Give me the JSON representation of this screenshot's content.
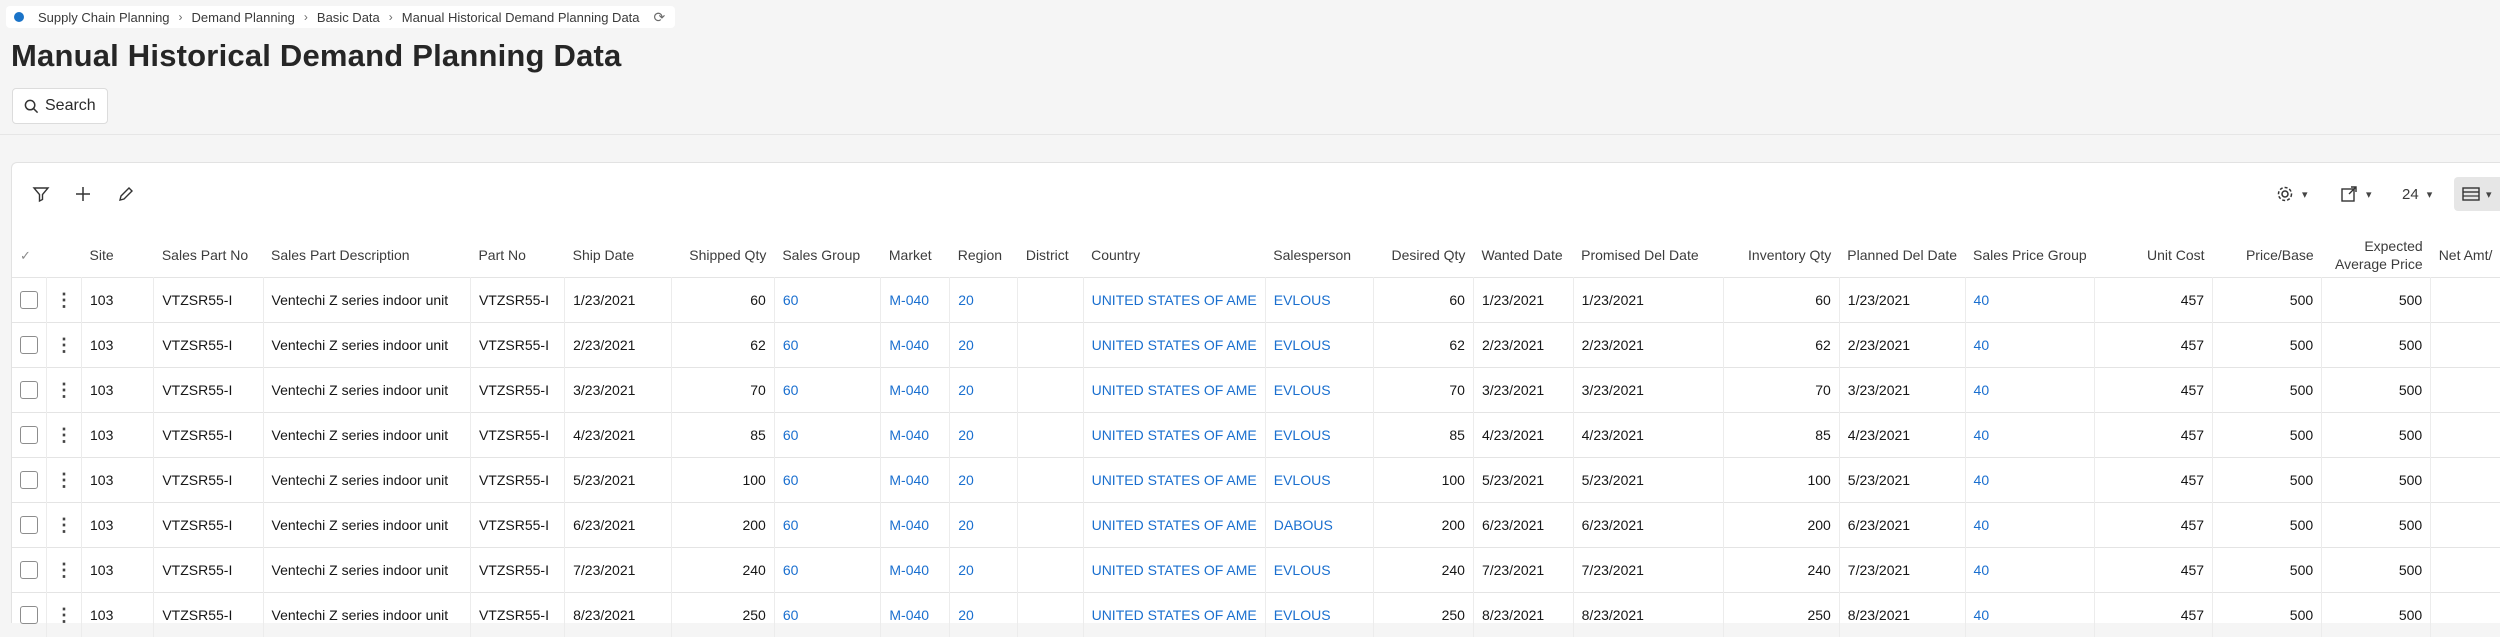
{
  "breadcrumb": [
    "Supply Chain Planning",
    "Demand Planning",
    "Basic Data",
    "Manual Historical Demand Planning Data"
  ],
  "page_title": "Manual Historical Demand Planning Data",
  "search_label": "Search",
  "toolbar": {
    "page_size": "24"
  },
  "columns": {
    "site": "Site",
    "sales_part_no": "Sales Part No",
    "sales_part_desc": "Sales Part Description",
    "part_no": "Part No",
    "ship_date": "Ship Date",
    "shipped_qty": "Shipped Qty",
    "sales_group": "Sales Group",
    "market": "Market",
    "region": "Region",
    "district": "District",
    "country": "Country",
    "salesperson": "Salesperson",
    "desired_qty": "Desired Qty",
    "wanted_date": "Wanted Date",
    "promised_del_date": "Promised Del Date",
    "inventory_qty": "Inventory Qty",
    "planned_del_date": "Planned Del Date",
    "sales_price_group": "Sales Price Group",
    "unit_cost": "Unit Cost",
    "price_base": "Price/Base",
    "expected_avg_price_1": "Expected",
    "expected_avg_price_2": "Average Price",
    "net_amt": "Net Amt/"
  },
  "rows": [
    {
      "site": "103",
      "sales_part_no": "VTZSR55-I",
      "sales_part_desc": "Ventechi Z series indoor unit",
      "part_no": "VTZSR55-I",
      "ship_date": "1/23/2021",
      "shipped_qty": "60",
      "sales_group": "60",
      "market": "M-040",
      "region": "20",
      "district": "",
      "country": "UNITED STATES OF AME",
      "salesperson": "EVLOUS",
      "desired_qty": "60",
      "wanted_date": "1/23/2021",
      "promised_del_date": "1/23/2021",
      "inventory_qty": "60",
      "planned_del_date": "1/23/2021",
      "sales_price_group": "40",
      "unit_cost": "457",
      "price_base": "500",
      "expected_avg_price": "500"
    },
    {
      "site": "103",
      "sales_part_no": "VTZSR55-I",
      "sales_part_desc": "Ventechi Z series indoor unit",
      "part_no": "VTZSR55-I",
      "ship_date": "2/23/2021",
      "shipped_qty": "62",
      "sales_group": "60",
      "market": "M-040",
      "region": "20",
      "district": "",
      "country": "UNITED STATES OF AME",
      "salesperson": "EVLOUS",
      "desired_qty": "62",
      "wanted_date": "2/23/2021",
      "promised_del_date": "2/23/2021",
      "inventory_qty": "62",
      "planned_del_date": "2/23/2021",
      "sales_price_group": "40",
      "unit_cost": "457",
      "price_base": "500",
      "expected_avg_price": "500"
    },
    {
      "site": "103",
      "sales_part_no": "VTZSR55-I",
      "sales_part_desc": "Ventechi Z series indoor unit",
      "part_no": "VTZSR55-I",
      "ship_date": "3/23/2021",
      "shipped_qty": "70",
      "sales_group": "60",
      "market": "M-040",
      "region": "20",
      "district": "",
      "country": "UNITED STATES OF AME",
      "salesperson": "EVLOUS",
      "desired_qty": "70",
      "wanted_date": "3/23/2021",
      "promised_del_date": "3/23/2021",
      "inventory_qty": "70",
      "planned_del_date": "3/23/2021",
      "sales_price_group": "40",
      "unit_cost": "457",
      "price_base": "500",
      "expected_avg_price": "500"
    },
    {
      "site": "103",
      "sales_part_no": "VTZSR55-I",
      "sales_part_desc": "Ventechi Z series indoor unit",
      "part_no": "VTZSR55-I",
      "ship_date": "4/23/2021",
      "shipped_qty": "85",
      "sales_group": "60",
      "market": "M-040",
      "region": "20",
      "district": "",
      "country": "UNITED STATES OF AME",
      "salesperson": "EVLOUS",
      "desired_qty": "85",
      "wanted_date": "4/23/2021",
      "promised_del_date": "4/23/2021",
      "inventory_qty": "85",
      "planned_del_date": "4/23/2021",
      "sales_price_group": "40",
      "unit_cost": "457",
      "price_base": "500",
      "expected_avg_price": "500"
    },
    {
      "site": "103",
      "sales_part_no": "VTZSR55-I",
      "sales_part_desc": "Ventechi Z series indoor unit",
      "part_no": "VTZSR55-I",
      "ship_date": "5/23/2021",
      "shipped_qty": "100",
      "sales_group": "60",
      "market": "M-040",
      "region": "20",
      "district": "",
      "country": "UNITED STATES OF AME",
      "salesperson": "EVLOUS",
      "desired_qty": "100",
      "wanted_date": "5/23/2021",
      "promised_del_date": "5/23/2021",
      "inventory_qty": "100",
      "planned_del_date": "5/23/2021",
      "sales_price_group": "40",
      "unit_cost": "457",
      "price_base": "500",
      "expected_avg_price": "500"
    },
    {
      "site": "103",
      "sales_part_no": "VTZSR55-I",
      "sales_part_desc": "Ventechi Z series indoor unit",
      "part_no": "VTZSR55-I",
      "ship_date": "6/23/2021",
      "shipped_qty": "200",
      "sales_group": "60",
      "market": "M-040",
      "region": "20",
      "district": "",
      "country": "UNITED STATES OF AME",
      "salesperson": "DABOUS",
      "desired_qty": "200",
      "wanted_date": "6/23/2021",
      "promised_del_date": "6/23/2021",
      "inventory_qty": "200",
      "planned_del_date": "6/23/2021",
      "sales_price_group": "40",
      "unit_cost": "457",
      "price_base": "500",
      "expected_avg_price": "500"
    },
    {
      "site": "103",
      "sales_part_no": "VTZSR55-I",
      "sales_part_desc": "Ventechi Z series indoor unit",
      "part_no": "VTZSR55-I",
      "ship_date": "7/23/2021",
      "shipped_qty": "240",
      "sales_group": "60",
      "market": "M-040",
      "region": "20",
      "district": "",
      "country": "UNITED STATES OF AME",
      "salesperson": "EVLOUS",
      "desired_qty": "240",
      "wanted_date": "7/23/2021",
      "promised_del_date": "7/23/2021",
      "inventory_qty": "240",
      "planned_del_date": "7/23/2021",
      "sales_price_group": "40",
      "unit_cost": "457",
      "price_base": "500",
      "expected_avg_price": "500"
    },
    {
      "site": "103",
      "sales_part_no": "VTZSR55-I",
      "sales_part_desc": "Ventechi Z series indoor unit",
      "part_no": "VTZSR55-I",
      "ship_date": "8/23/2021",
      "shipped_qty": "250",
      "sales_group": "60",
      "market": "M-040",
      "region": "20",
      "district": "",
      "country": "UNITED STATES OF AME",
      "salesperson": "EVLOUS",
      "desired_qty": "250",
      "wanted_date": "8/23/2021",
      "promised_del_date": "8/23/2021",
      "inventory_qty": "250",
      "planned_del_date": "8/23/2021",
      "sales_price_group": "40",
      "unit_cost": "457",
      "price_base": "500",
      "expected_avg_price": "500"
    }
  ]
}
